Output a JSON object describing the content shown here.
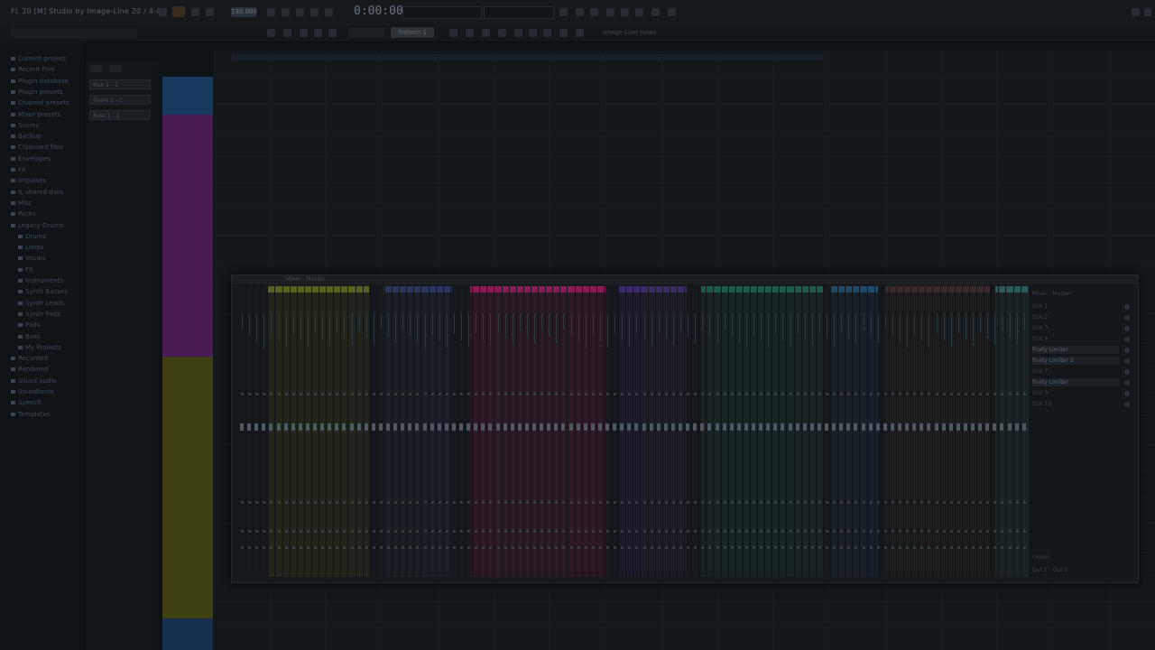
{
  "window": {
    "title": "FL 20 [M] Studio by Image-Line 20 / 4:4",
    "transport_time": "0:00:00",
    "tempo": "130.000",
    "hint_button": "Pattern 1",
    "hint_text": "Image-Line news"
  },
  "browser": {
    "items": [
      {
        "label": "Current project",
        "sub": false
      },
      {
        "label": "Recent files",
        "sub": false
      },
      {
        "label": "Plugin database",
        "sub": false
      },
      {
        "label": "Plugin presets",
        "sub": false
      },
      {
        "label": "Channel presets",
        "sub": false
      },
      {
        "label": "Mixer presets",
        "sub": false
      },
      {
        "label": "Scores",
        "sub": false
      },
      {
        "label": "Backup",
        "sub": false
      },
      {
        "label": "Clipboard files",
        "sub": false
      },
      {
        "label": "Envelopes",
        "sub": false
      },
      {
        "label": "FX",
        "sub": false
      },
      {
        "label": "Impulses",
        "sub": false
      },
      {
        "label": "IL shared data",
        "sub": false
      },
      {
        "label": "Misc",
        "sub": false
      },
      {
        "label": "Packs",
        "sub": false
      },
      {
        "label": "Legacy Drums",
        "sub": false
      },
      {
        "label": "Drums",
        "sub": true
      },
      {
        "label": "Loops",
        "sub": true
      },
      {
        "label": "Vocals",
        "sub": true
      },
      {
        "label": "FX",
        "sub": true
      },
      {
        "label": "Instruments",
        "sub": true
      },
      {
        "label": "Synth Basses",
        "sub": true
      },
      {
        "label": "Synth Leads",
        "sub": true
      },
      {
        "label": "Synth Pads",
        "sub": true
      },
      {
        "label": "Pads",
        "sub": true
      },
      {
        "label": "Bass",
        "sub": true
      },
      {
        "label": "My Projects",
        "sub": true
      },
      {
        "label": "Recorded",
        "sub": false
      },
      {
        "label": "Rendered",
        "sub": false
      },
      {
        "label": "Sliced audio",
        "sub": false
      },
      {
        "label": "Soundfonts",
        "sub": false
      },
      {
        "label": "Speech",
        "sub": false
      },
      {
        "label": "Templates",
        "sub": false
      }
    ]
  },
  "channel_rack": {
    "items": [
      "Kick 1 - 1",
      "Snare 1 - 1",
      "Bass 1 - 1"
    ]
  },
  "mixer": {
    "title": "Mixer - Master",
    "insert_title": "Mixer - Master",
    "slots": [
      {
        "label": "Slot 1",
        "on": false
      },
      {
        "label": "Slot 2",
        "on": false
      },
      {
        "label": "Slot 3",
        "on": false
      },
      {
        "label": "Slot 4",
        "on": false
      },
      {
        "label": "Fruity Limiter",
        "on": true
      },
      {
        "label": "Fruity Limiter 2",
        "on": true
      },
      {
        "label": "Slot 7",
        "on": false
      },
      {
        "label": "Fruity Limiter",
        "on": true
      },
      {
        "label": "Slot 9",
        "on": false
      },
      {
        "label": "Slot 10",
        "on": false
      }
    ],
    "out_label": "Out 1 - Out 2",
    "in_label": "(none)",
    "group_colors": [
      "#5a6020",
      "#2a3560",
      "#8a1a55",
      "#3a2a6a",
      "#1c5a4a",
      "#1f4a6a",
      "#3a2a2a",
      "#2a5a5a"
    ]
  },
  "colors": {
    "track_blue": "#1d4a78",
    "track_purple": "#5a1f66",
    "track_yellow": "#5a5a1c"
  }
}
